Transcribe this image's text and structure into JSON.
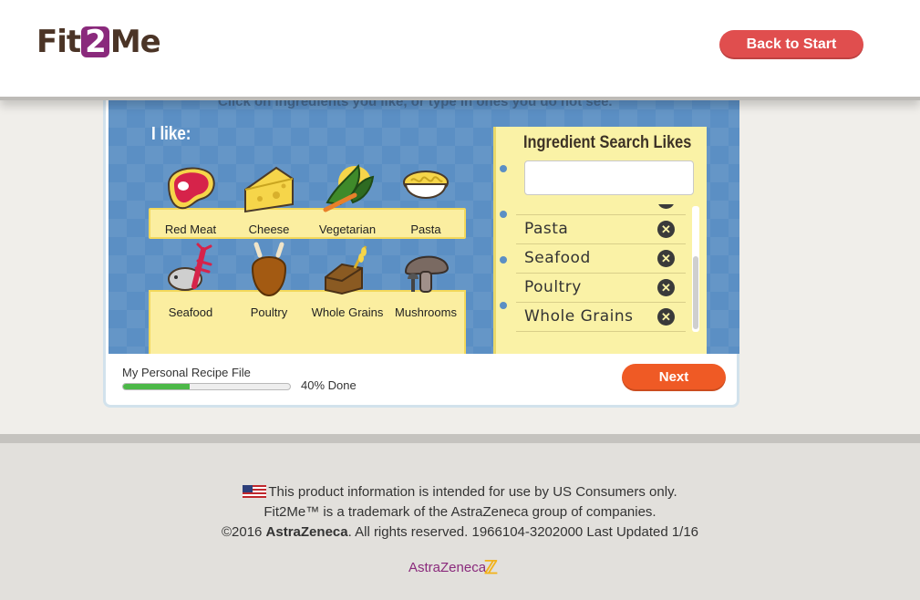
{
  "header": {
    "logo_left": "Fit",
    "logo_mid": "2",
    "logo_right": "Me",
    "back_label": "Back to Start"
  },
  "stage": {
    "instructions": "Click on ingredients you like, or type in ones you do not see.",
    "heading": "I like:",
    "foods": [
      {
        "label": "Red Meat",
        "icon": "red-meat-icon"
      },
      {
        "label": "Cheese",
        "icon": "cheese-icon"
      },
      {
        "label": "Vegetarian",
        "icon": "vegetables-icon"
      },
      {
        "label": "Pasta",
        "icon": "pasta-icon"
      },
      {
        "label": "Seafood",
        "icon": "lobster-fish-icon"
      },
      {
        "label": "Poultry",
        "icon": "turkey-icon"
      },
      {
        "label": "Whole Grains",
        "icon": "bread-wheat-icon"
      },
      {
        "label": "Mushrooms",
        "icon": "mushroom-icon"
      }
    ]
  },
  "notepad": {
    "title": "Ingredient Search Likes",
    "search_value": "",
    "items": [
      "Pasta",
      "Seafood",
      "Poultry",
      "Whole Grains"
    ],
    "remove_glyph": "✕"
  },
  "progress": {
    "label": "My Personal Recipe File",
    "percent": 40,
    "text": "40% Done",
    "next_label": "Next"
  },
  "footer": {
    "line1": "This product information is intended for use by US Consumers only.",
    "line2": "Fit2Me™ is a trademark of the AstraZeneca group of companies.",
    "line3_pre": "©2016 ",
    "line3_bold": "AstraZeneca",
    "line3_post": ". All rights reserved. 1966104-3202000 Last Updated 1/16",
    "brand": "AstraZeneca"
  },
  "colors": {
    "brand_purple": "#8a2a7c",
    "brown": "#4b3426",
    "back_button": "#e04e4e",
    "next_button": "#ef5a25",
    "stage_blue": "#5b8fc4",
    "progress_green": "#4cb848"
  }
}
